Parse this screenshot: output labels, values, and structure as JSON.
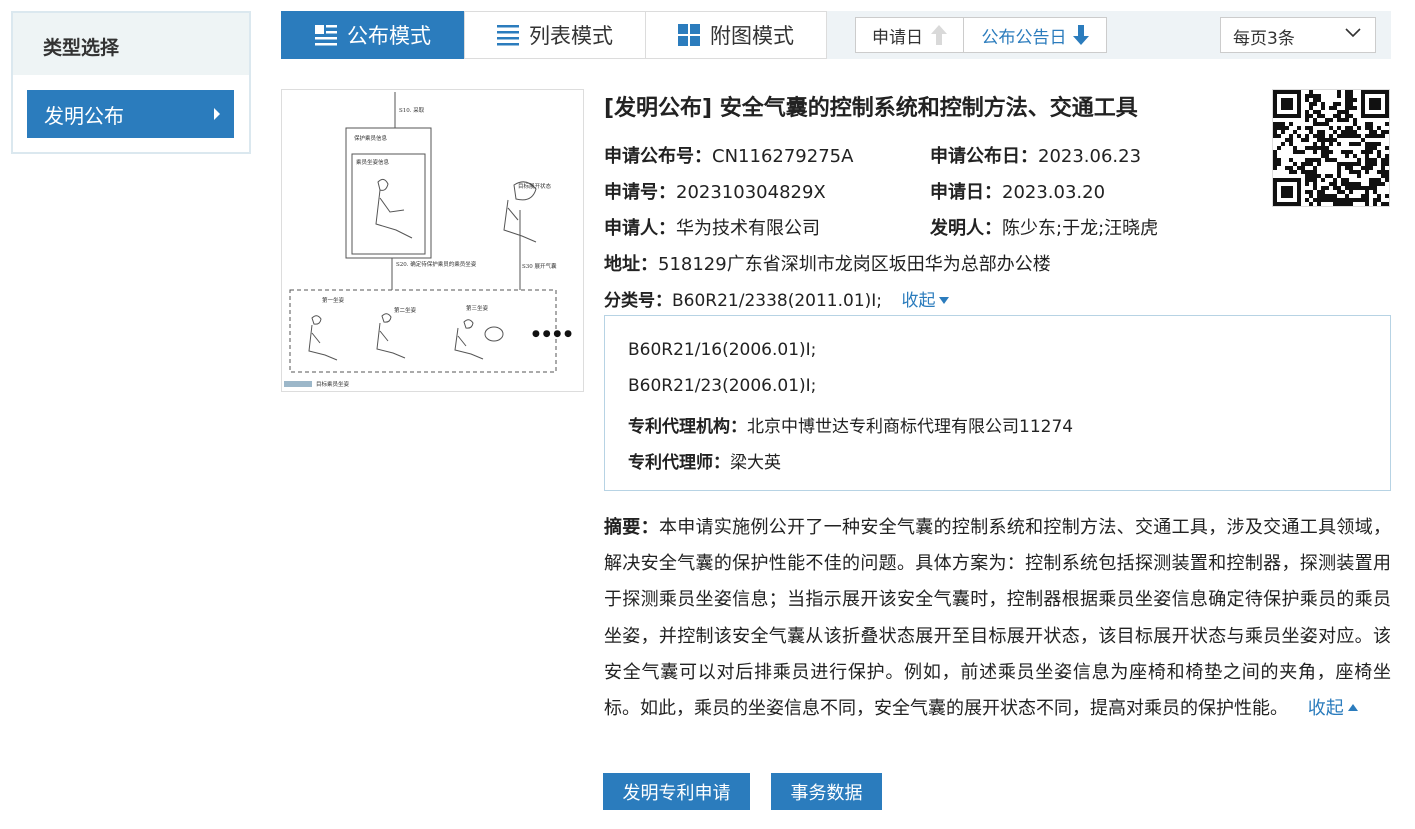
{
  "sidebar": {
    "title": "类型选择",
    "items": [
      {
        "label": "发明公布"
      }
    ]
  },
  "toolbar": {
    "modes": [
      {
        "label": "公布模式",
        "active": true
      },
      {
        "label": "列表模式",
        "active": false
      },
      {
        "label": "附图模式",
        "active": false
      }
    ],
    "sort": [
      {
        "label": "申请日",
        "direction": "up",
        "active": false
      },
      {
        "label": "公布公告日",
        "direction": "down",
        "active": true
      }
    ],
    "per_page": "每页3条"
  },
  "record": {
    "title": "[发明公布] 安全气囊的控制系统和控制方法、交通工具",
    "pub_no_label": "申请公布号：",
    "pub_no": "CN116279275A",
    "pub_date_label": "申请公布日：",
    "pub_date": "2023.06.23",
    "app_no_label": "申请号：",
    "app_no": "202310304829X",
    "app_date_label": "申请日：",
    "app_date": "2023.03.20",
    "applicant_label": "申请人：",
    "applicant": "华为技术有限公司",
    "inventor_label": "发明人：",
    "inventor": "陈少东;于龙;汪晓虎",
    "address_label": "地址：",
    "address": "518129广东省深圳市龙岗区坂田华为总部办公楼",
    "class_label": "分类号：",
    "class_value": "B60R21/2338(2011.01)I;",
    "collapse": "收起",
    "details": {
      "class_line1": "B60R21/16(2006.01)I;",
      "class_line2": "B60R21/23(2006.01)I;",
      "agency_label": "专利代理机构：",
      "agency": "北京中博世达专利商标代理有限公司11274",
      "agent_label": "专利代理师：",
      "agent": "梁大英"
    },
    "abstract_label": "摘要：",
    "abstract": "本申请实施例公开了一种安全气囊的控制系统和控制方法、交通工具，涉及交通工具领域，解决安全气囊的保护性能不佳的问题。具体方案为：控制系统包括探测装置和控制器，探测装置用于探测乘员坐姿信息；当指示展开该安全气囊时，控制器根据乘员坐姿信息确定待保护乘员的乘员坐姿，并控制该安全气囊从该折叠状态展开至目标展开状态，该目标展开状态与乘员坐姿对应。该安全气囊可以对后排乘员进行保护。例如，前述乘员坐姿信息为座椅和椅垫之间的夹角，座椅坐标。如此，乘员的坐姿信息不同，安全气囊的展开状态不同，提高对乘员的保护性能。",
    "abstract_collapse": "收起",
    "figure_labels": {
      "s10": "S10. 采取",
      "box_title": "保护乘员信息",
      "inner_title": "乘员坐姿信息",
      "s20": "S20. 确定待保护乘员的乘员坐姿",
      "s30": "S30 展开气囊",
      "target_state": "目标展开状态",
      "pose1": "第一坐姿",
      "pose2": "第二坐姿",
      "pose3": "第三坐姿",
      "ellipsis": "● ● ● ●",
      "footer": "目标乘员坐姿"
    }
  },
  "actions": [
    {
      "label": "发明专利申请"
    },
    {
      "label": "事务数据"
    }
  ],
  "colors": {
    "primary": "#2b7cbd",
    "sidebar_head": "#eef4f5",
    "border": "#b7d3e4"
  }
}
